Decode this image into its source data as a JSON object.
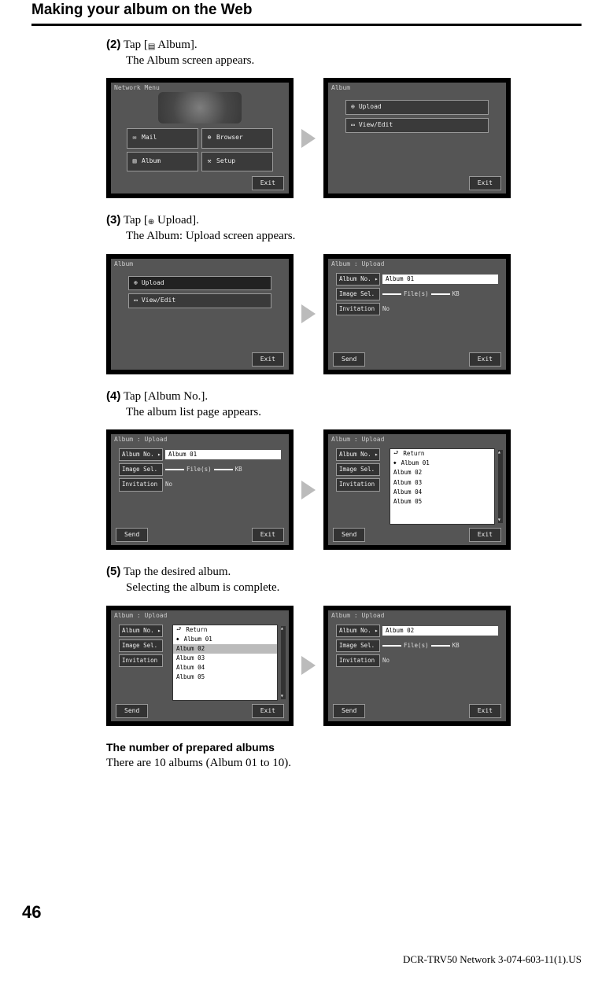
{
  "header": {
    "title": "Making your album on the Web"
  },
  "steps": {
    "s2": {
      "num": "(2)",
      "text_a": "Tap [",
      "icon": "album-icon",
      "text_b": " Album].",
      "sub": "The Album screen appears."
    },
    "s3": {
      "num": "(3)",
      "text_a": "Tap [",
      "icon": "upload-icon",
      "text_b": " Upload].",
      "sub": "The Album: Upload screen appears."
    },
    "s4": {
      "num": "(4)",
      "text": "Tap [Album No.].",
      "sub": "The album list page appears."
    },
    "s5": {
      "num": "(5)",
      "text": "Tap the desired album.",
      "sub": "Selecting the album is complete."
    }
  },
  "note": {
    "heading": "The number of prepared albums",
    "body": "There are 10 albums (Album 01 to 10)."
  },
  "screens": {
    "network_menu": {
      "title": "Network Menu",
      "mail": "Mail",
      "browser": "Browser",
      "album": "Album",
      "setup": "Setup",
      "exit": "Exit"
    },
    "album_menu": {
      "title": "Album",
      "upload": "Upload",
      "viewedit": "View/Edit",
      "exit": "Exit"
    },
    "upload_form": {
      "title": "Album : Upload",
      "album_no_label": "Album No.",
      "album_no_value_01": "Album 01",
      "album_no_value_02": "Album 02",
      "image_sel_label": "Image Sel.",
      "files": "File(s)",
      "kb": "KB",
      "invitation_label": "Invitation",
      "invitation_value": "No",
      "send": "Send",
      "exit": "Exit"
    },
    "album_list": {
      "return": "Return",
      "items": [
        "Album 01",
        "Album 02",
        "Album 03",
        "Album 04",
        "Album 05"
      ]
    }
  },
  "page_number": "46",
  "footer_id": "DCR-TRV50 Network 3-074-603-11(1).US"
}
